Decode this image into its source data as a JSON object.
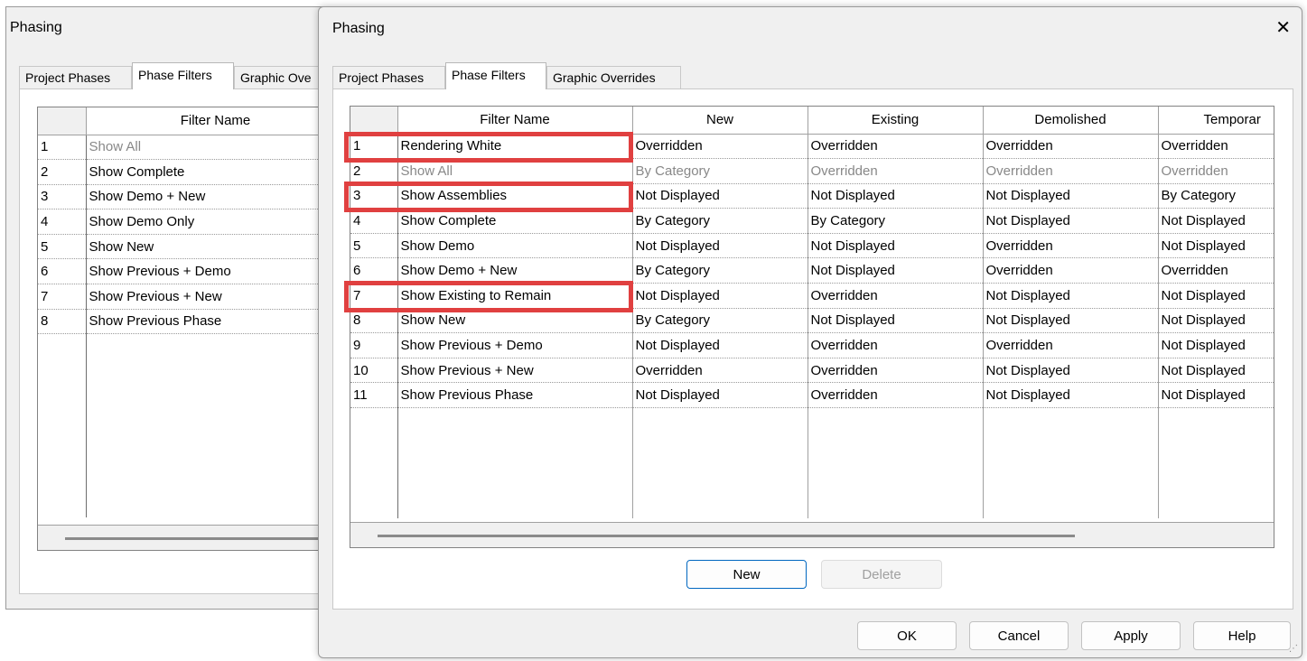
{
  "bg_dialog": {
    "title": "Phasing",
    "tabs": [
      "Project Phases",
      "Phase Filters",
      "Graphic Ove"
    ],
    "header": "Filter Name",
    "rows": [
      {
        "num": "1",
        "name": "Show All"
      },
      {
        "num": "2",
        "name": "Show Complete"
      },
      {
        "num": "3",
        "name": "Show Demo + New"
      },
      {
        "num": "4",
        "name": "Show Demo Only"
      },
      {
        "num": "5",
        "name": "Show New"
      },
      {
        "num": "6",
        "name": "Show Previous + Demo"
      },
      {
        "num": "7",
        "name": "Show Previous + New"
      },
      {
        "num": "8",
        "name": "Show Previous Phase"
      }
    ]
  },
  "fg_dialog": {
    "title": "Phasing",
    "close_icon": "close-icon",
    "tabs": [
      "Project Phases",
      "Phase Filters",
      "Graphic Overrides"
    ],
    "active_tab": "Phase Filters",
    "headers": [
      "Filter Name",
      "New",
      "Existing",
      "Demolished",
      "Temporar"
    ],
    "rows": [
      {
        "num": "1",
        "cells": [
          "Rendering White",
          "Overridden",
          "Overridden",
          "Overridden",
          "Overridden"
        ],
        "gray": false,
        "highlighted": true
      },
      {
        "num": "2",
        "cells": [
          "Show All",
          "By Category",
          "Overridden",
          "Overridden",
          "Overridden"
        ],
        "gray": true,
        "highlighted": false
      },
      {
        "num": "3",
        "cells": [
          "Show Assemblies",
          "Not Displayed",
          "Not Displayed",
          "Not Displayed",
          "By Category"
        ],
        "gray": false,
        "highlighted": true
      },
      {
        "num": "4",
        "cells": [
          "Show Complete",
          "By Category",
          "By Category",
          "Not Displayed",
          "Not Displayed"
        ],
        "gray": false,
        "highlighted": false
      },
      {
        "num": "5",
        "cells": [
          "Show Demo",
          "Not Displayed",
          "Not Displayed",
          "Overridden",
          "Not Displayed"
        ],
        "gray": false,
        "highlighted": false
      },
      {
        "num": "6",
        "cells": [
          "Show Demo + New",
          "By Category",
          "Not Displayed",
          "Overridden",
          "Overridden"
        ],
        "gray": false,
        "highlighted": false
      },
      {
        "num": "7",
        "cells": [
          "Show Existing to Remain",
          "Not Displayed",
          "Overridden",
          "Not Displayed",
          "Not Displayed"
        ],
        "gray": false,
        "highlighted": true
      },
      {
        "num": "8",
        "cells": [
          "Show New",
          "By Category",
          "Not Displayed",
          "Not Displayed",
          "Not Displayed"
        ],
        "gray": false,
        "highlighted": false
      },
      {
        "num": "9",
        "cells": [
          "Show Previous + Demo",
          "Not Displayed",
          "Overridden",
          "Overridden",
          "Not Displayed"
        ],
        "gray": false,
        "highlighted": false
      },
      {
        "num": "10",
        "cells": [
          "Show Previous + New",
          "Overridden",
          "Overridden",
          "Not Displayed",
          "Not Displayed"
        ],
        "gray": false,
        "highlighted": false
      },
      {
        "num": "11",
        "cells": [
          "Show Previous Phase",
          "Not Displayed",
          "Overridden",
          "Not Displayed",
          "Not Displayed"
        ],
        "gray": false,
        "highlighted": false
      }
    ],
    "buttons": {
      "new": "New",
      "delete": "Delete",
      "ok": "OK",
      "cancel": "Cancel",
      "apply": "Apply",
      "help": "Help"
    },
    "highlight_color": "#e04040"
  }
}
